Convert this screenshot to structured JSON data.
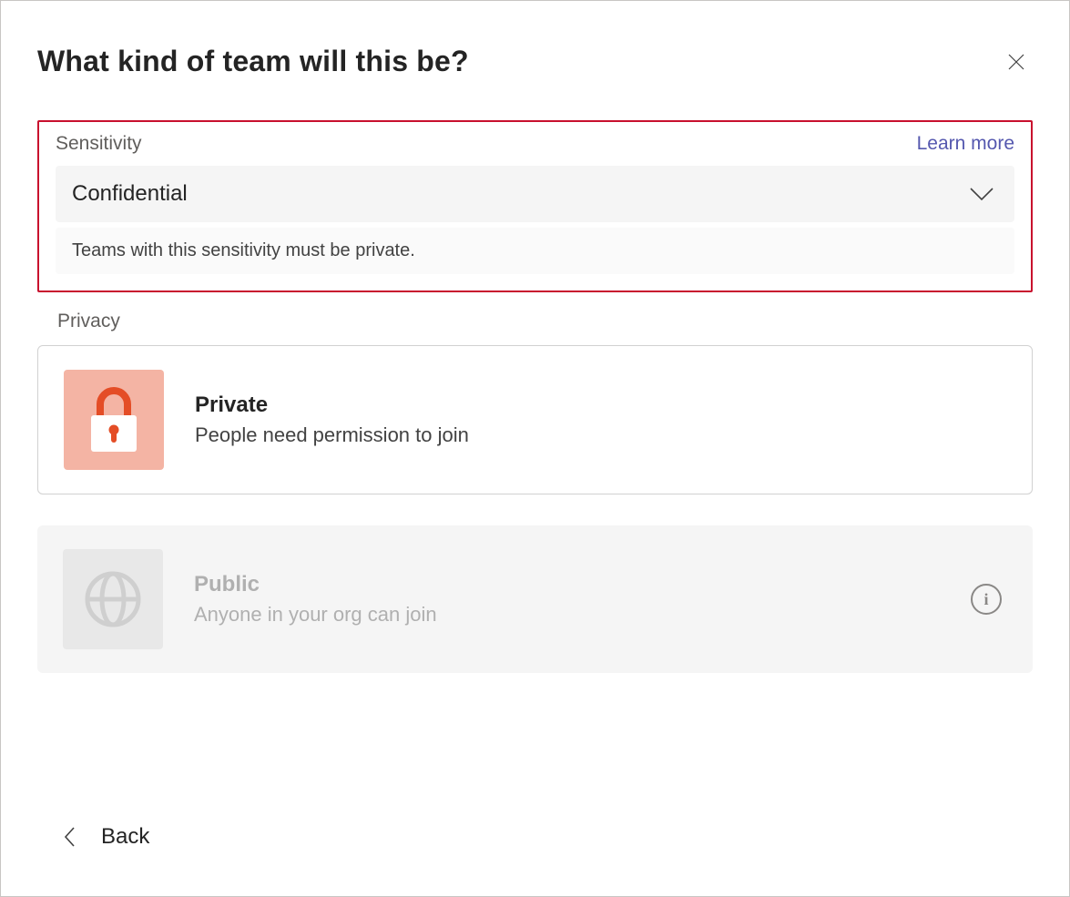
{
  "header": {
    "title": "What kind of team will this be?"
  },
  "sensitivity": {
    "label": "Sensitivity",
    "learn_more": "Learn more",
    "selected": "Confidential",
    "hint": "Teams with this sensitivity must be private."
  },
  "privacy": {
    "label": "Privacy",
    "private": {
      "title": "Private",
      "desc": "People need permission to join"
    },
    "public": {
      "title": "Public",
      "desc": "Anyone in your org can join"
    }
  },
  "footer": {
    "back": "Back"
  }
}
